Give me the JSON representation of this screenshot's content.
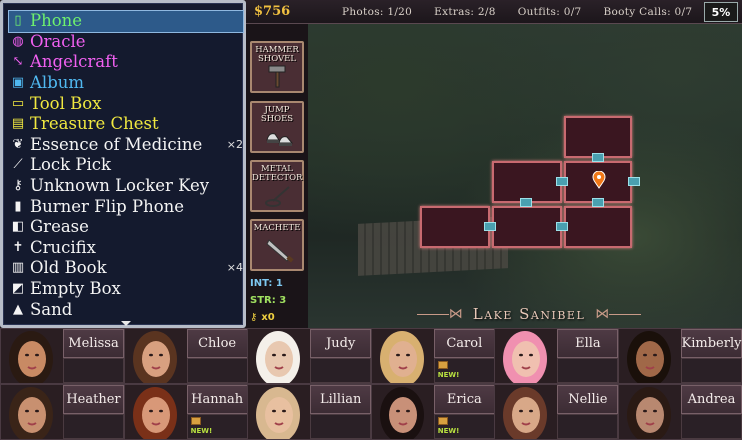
{
  "inventory": {
    "items": [
      {
        "label": "Phone",
        "color": "#6ef06e",
        "icon": "phone-icon",
        "glyph": "▯",
        "qty": "",
        "selected": true
      },
      {
        "label": "Oracle",
        "color": "#f060f0",
        "icon": "oracle-icon",
        "glyph": "◍",
        "qty": ""
      },
      {
        "label": "Angelcraft",
        "color": "#f060f0",
        "icon": "angelcraft-icon",
        "glyph": "⤡",
        "qty": ""
      },
      {
        "label": "Album",
        "color": "#50b8f0",
        "icon": "album-icon",
        "glyph": "▣",
        "qty": ""
      },
      {
        "label": "Tool Box",
        "color": "#f0e840",
        "icon": "toolbox-icon",
        "glyph": "▭",
        "qty": ""
      },
      {
        "label": "Treasure Chest",
        "color": "#f0e840",
        "icon": "treasure-chest-icon",
        "glyph": "▤",
        "qty": ""
      },
      {
        "label": "Essence of Medicine",
        "color": "#f4f4f4",
        "icon": "medicine-icon",
        "glyph": "❦",
        "qty": "×2"
      },
      {
        "label": "Lock Pick",
        "color": "#f4f4f4",
        "icon": "lock-pick-icon",
        "glyph": "⟋",
        "qty": ""
      },
      {
        "label": "Unknown Locker Key",
        "color": "#f4f4f4",
        "icon": "key-icon",
        "glyph": "⚷",
        "qty": ""
      },
      {
        "label": "Burner Flip Phone",
        "color": "#f4f4f4",
        "icon": "flip-phone-icon",
        "glyph": "▮",
        "qty": ""
      },
      {
        "label": "Grease",
        "color": "#f4f4f4",
        "icon": "grease-icon",
        "glyph": "◧",
        "qty": ""
      },
      {
        "label": "Crucifix",
        "color": "#f4f4f4",
        "icon": "crucifix-icon",
        "glyph": "✝",
        "qty": ""
      },
      {
        "label": "Old Book",
        "color": "#f4f4f4",
        "icon": "book-icon",
        "glyph": "▥",
        "qty": "×4"
      },
      {
        "label": "Empty Box",
        "color": "#f4f4f4",
        "icon": "box-icon",
        "glyph": "◩",
        "qty": ""
      },
      {
        "label": "Sand",
        "color": "#f4f4f4",
        "icon": "sand-icon",
        "glyph": "▲",
        "qty": ""
      }
    ]
  },
  "topbar": {
    "money": "$756",
    "photos": "Photos: 1/20",
    "extras": "Extras: 2/8",
    "outfits": "Outfits: 0/7",
    "booty_calls": "Booty Calls: 0/7",
    "percent": "5%"
  },
  "tools": {
    "hammer": "HAMMER SHOVEL",
    "jump": "JUMP SHOES",
    "metal": "METAL DETECTOR",
    "machete": "MACHETE"
  },
  "stats": {
    "int": "INT: 1",
    "str": "STR: 3",
    "keys": "x0"
  },
  "map": {
    "location": "Lake Sanibel"
  },
  "characters": [
    {
      "name": "Melissa",
      "new": "",
      "book": false,
      "skin": "#c88a64",
      "hair": "#2a1a12"
    },
    {
      "name": "Chloe",
      "new": "",
      "book": false,
      "skin": "#d8a080",
      "hair": "#5a3420"
    },
    {
      "name": "Judy",
      "new": "",
      "book": false,
      "skin": "#e8c8b0",
      "hair": "#f4f0ea"
    },
    {
      "name": "Carol",
      "new": "NEW!",
      "book": true,
      "skin": "#e0b090",
      "hair": "#d8b070"
    },
    {
      "name": "Ella",
      "new": "",
      "book": false,
      "skin": "#f0c0b0",
      "hair": "#f090b0"
    },
    {
      "name": "Kimberly",
      "new": "",
      "book": false,
      "skin": "#a06848",
      "hair": "#1a100a"
    },
    {
      "name": "Heather",
      "new": "",
      "book": false,
      "skin": "#c89070",
      "hair": "#3a2418"
    },
    {
      "name": "Hannah",
      "new": "NEW!",
      "book": true,
      "skin": "#d89878",
      "hair": "#7a3018"
    },
    {
      "name": "Lillian",
      "new": "",
      "book": false,
      "skin": "#e8c0a0",
      "hair": "#d8b890"
    },
    {
      "name": "Erica",
      "new": "NEW!",
      "book": true,
      "skin": "#c89078",
      "hair": "#1a1010"
    },
    {
      "name": "Nellie",
      "new": "",
      "book": false,
      "skin": "#d8a888",
      "hair": "#6a3a2a"
    },
    {
      "name": "Andrea",
      "new": "",
      "book": false,
      "skin": "#b88870",
      "hair": "#2a1a14"
    }
  ]
}
